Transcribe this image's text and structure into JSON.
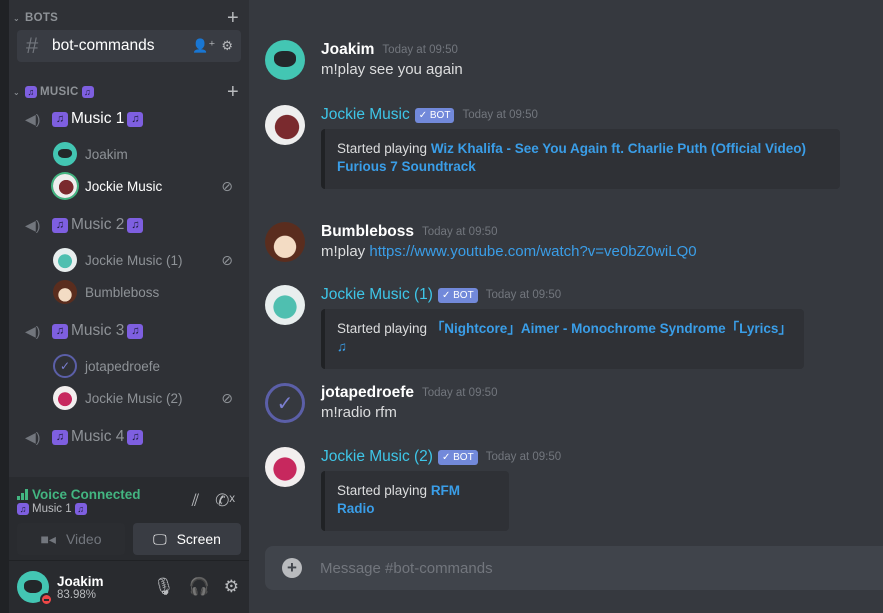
{
  "sidebar": {
    "categories": [
      {
        "label": "BOTS",
        "add": "+"
      },
      {
        "label": "MUSIC",
        "add": "+"
      }
    ],
    "text_channel": {
      "name": "bot-commands",
      "hash": "#"
    },
    "voice_channels": [
      {
        "name": "Music 1",
        "users": [
          {
            "name": "Joakim",
            "speaking": false,
            "muted": false
          },
          {
            "name": "Jockie Music",
            "speaking": true,
            "muted": true
          }
        ]
      },
      {
        "name": "Music 2",
        "users": [
          {
            "name": "Jockie Music (1)",
            "muted": true
          },
          {
            "name": "Bumbleboss",
            "muted": false
          }
        ]
      },
      {
        "name": "Music 3",
        "users": [
          {
            "name": "jotapedroefe",
            "muted": false
          },
          {
            "name": "Jockie Music (2)",
            "muted": true
          }
        ]
      },
      {
        "name": "Music 4",
        "users": []
      }
    ],
    "voice_panel": {
      "status": "Voice Connected",
      "channel": "Music 1",
      "video_label": "Video",
      "screen_label": "Screen"
    },
    "user_panel": {
      "username": "Joakim",
      "status": "83.98%"
    }
  },
  "icons": {
    "note": "♫",
    "speaker": "🔈",
    "mute": "⊘",
    "check": "✓"
  },
  "messages": [
    {
      "author": "Joakim",
      "timestamp": "Today at 09:50",
      "text": "m!play see you again"
    },
    {
      "author": "Jockie Music",
      "bot": true,
      "badge": "✓ BOT",
      "timestamp": "Today at 09:50",
      "embed_prefix": "Started playing ",
      "embed_song_1": "Wiz Khalifa - See You Again ft. Charlie Puth (Official Video)",
      "embed_song_2": "Furious 7 Soundtrack"
    },
    {
      "author": "Bumbleboss",
      "timestamp": "Today at 09:50",
      "text": "m!play ",
      "link": "https://www.youtube.com/watch?v=ve0bZ0wiLQ0"
    },
    {
      "author": "Jockie Music (1)",
      "bot": true,
      "badge": "✓ BOT",
      "timestamp": "Today at 09:50",
      "embed_prefix": "Started playing ",
      "embed_song": "「Nightcore」Aimer - Monochrome Syndrome「Lyrics」♫"
    },
    {
      "author": "jotapedroefe",
      "timestamp": "Today at 09:50",
      "text": "m!radio rfm"
    },
    {
      "author": "Jockie Music (2)",
      "bot": true,
      "badge": "✓ BOT",
      "timestamp": "Today at 09:50",
      "embed_prefix": "Started playing ",
      "embed_song": "RFM Radio"
    }
  ],
  "composer": {
    "placeholder": "Message #bot-commands"
  },
  "colors": {
    "accent": "#7289da",
    "online": "#43b581",
    "link": "#3a9ee8",
    "bot_name": "#3ec6e8"
  }
}
